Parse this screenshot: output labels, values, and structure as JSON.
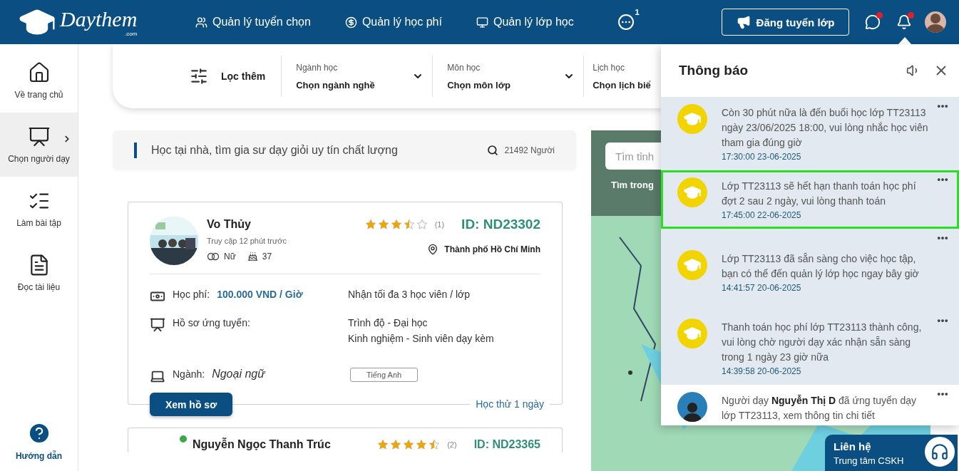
{
  "header": {
    "logo": {
      "name": "Daythem",
      "suffix": ".com"
    },
    "nav": [
      {
        "kind": "users",
        "label": "Quản lý tuyển chọn"
      },
      {
        "kind": "fee",
        "label": "Quản lý học phí"
      },
      {
        "kind": "class",
        "label": "Quản lý lớp học"
      }
    ],
    "more_badge": "1",
    "post_button": "Đăng tuyển lớp",
    "chat_unread": true,
    "bell_unread": true
  },
  "sidebar": {
    "items": [
      {
        "kind": "home",
        "label": "Về trang chủ",
        "selected": false
      },
      {
        "kind": "teacher",
        "label": "Chọn người dạy",
        "selected": true
      },
      {
        "kind": "exercise",
        "label": "Làm bài tập",
        "selected": false
      },
      {
        "kind": "document",
        "label": "Đọc tài liệu",
        "selected": false
      }
    ],
    "help": "Hướng dẫn"
  },
  "filter": {
    "label": "Lọc thêm",
    "fields": [
      {
        "label": "Ngành học",
        "value": "Chọn ngành nghề",
        "dropdown": true
      },
      {
        "label": "Môn học",
        "value": "Chọn môn lớp",
        "dropdown": true
      },
      {
        "label": "Lịch học",
        "value": "Chọn lịch biể",
        "dropdown": false
      }
    ]
  },
  "search": {
    "placeholder": "Học tại nhà, tìm gia sư dạy giỏi uy tín chất lượng",
    "count": "21492 Người"
  },
  "tutors": [
    {
      "name": "Vo Thủy",
      "last_seen": "Truy cập 12 phút trước",
      "gender": "Nữ",
      "age": "37",
      "location": "Thành phố Hồ Chí Minh",
      "stars": 3.5,
      "reviews": "(1)",
      "id": "ID: ND23302",
      "online": false,
      "fee_label": "Học phí:",
      "fee": "100.000 VND / Giờ",
      "capacity": "Nhận tối đa 3 học viên / lớp",
      "profile_label": "Hồ sơ ứng tuyển:",
      "profile_lines": [
        "Trình độ - Đại học",
        "Kinh nghiệm - Sinh viên dạy kèm"
      ],
      "major_label": "Ngành:",
      "major": "Ngoại ngữ",
      "tag": "Tiếng Anh",
      "button": "Xem hồ sơ",
      "trial": "Học thử 1 ngày"
    },
    {
      "name": "Nguyễn Ngọc Thanh Trúc",
      "stars": 4.5,
      "reviews": "(2)",
      "id": "ID: ND23365",
      "online": true
    }
  ],
  "map": {
    "kind": "picture",
    "search_placeholder": "Tìm tỉnh",
    "toggle_label": "Tìm trong"
  },
  "contact": {
    "title": "Liên hệ",
    "subtitle": "Trung tâm CSKH"
  },
  "notifications": {
    "title": "Thông báo",
    "items": [
      {
        "kind": "system",
        "text": "Còn 30 phút nữa là đến buổi học lớp TT23113 ngày 23/06/2025 18:00, vui lòng nhắc học viên tham gia đúng giờ",
        "time": "17:30:00 23-06-2025",
        "unread": true,
        "selected": false
      },
      {
        "kind": "system",
        "text": "Lớp TT23113 sẽ hết hạn thanh toán học phí đợt 2 sau 2 ngày, vui lòng thanh toán",
        "time": "17:45:00 22-06-2025",
        "unread": true,
        "selected": true
      },
      {
        "kind": "system",
        "text": "Lớp TT23113 đã sẵn sàng cho việc học tập, bạn có thể đến quản lý lớp học ngay bây giờ",
        "time": "14:41:57 20-06-2025",
        "unread": true,
        "selected": false
      },
      {
        "kind": "system",
        "text": "Thanh toán học phí lớp TT23113 thành công, vui lòng chờ người dạy xác nhận sẵn sàng trong 1 ngày 23 giờ nữa",
        "time": "14:39:58 20-06-2025",
        "unread": true,
        "selected": false
      },
      {
        "kind": "tutor",
        "text": "Người dạy **Nguyễn Thị D** đã ứng tuyển dạy lớp TT23113, xem thông tin chi tiết",
        "unread": false,
        "selected": false
      }
    ]
  }
}
